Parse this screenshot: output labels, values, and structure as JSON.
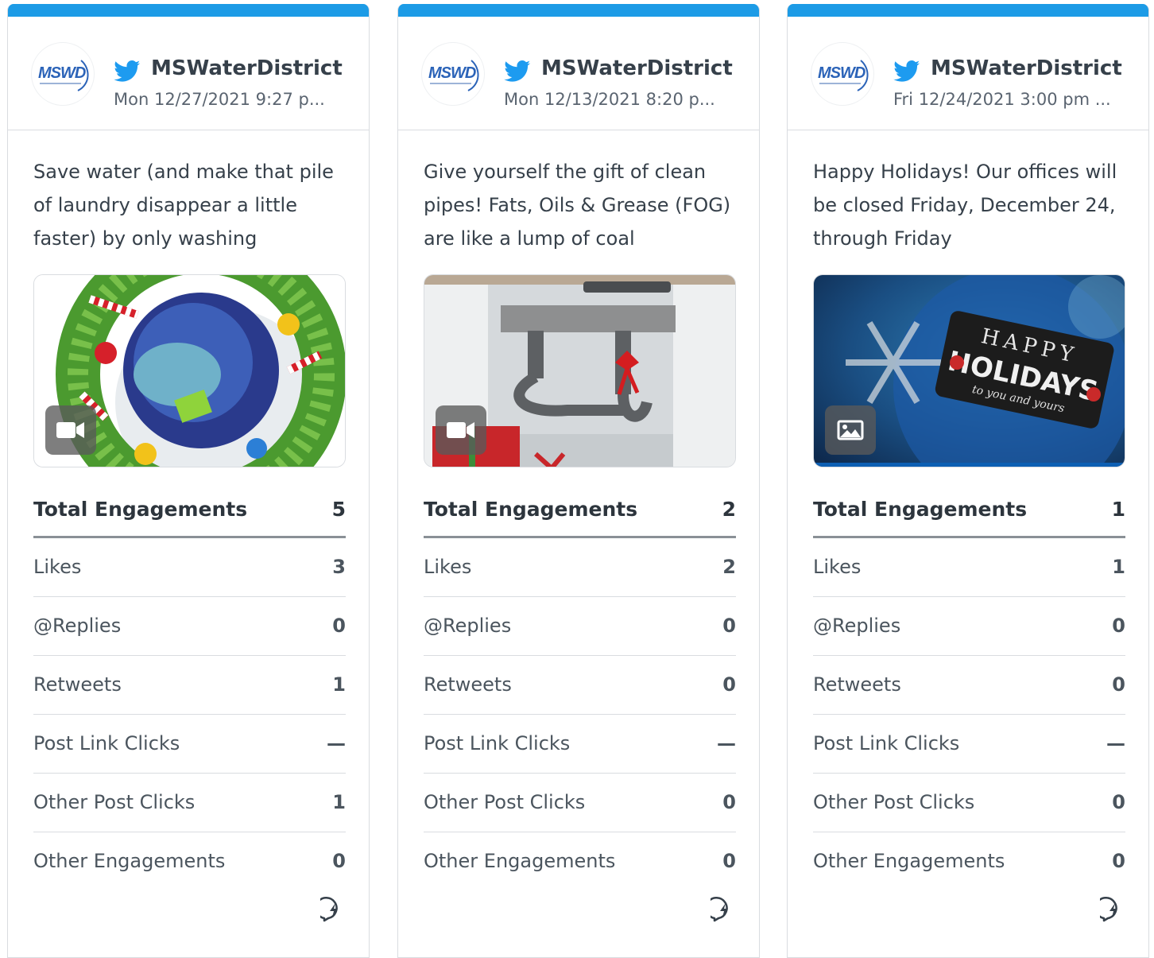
{
  "colors": {
    "accent": "#1c9be6",
    "twitter_blue": "#1d9bf0",
    "text": "#36404a",
    "muted": "#5a6470",
    "border": "#d9dce0"
  },
  "cards": [
    {
      "account": "MSWaterDistrict",
      "timestamp": "Mon 12/27/2021 9:27 p...",
      "text": "Save water (and make that pile of laundry disappear a little faster) by only washing",
      "media_type": "video",
      "media_icon": "video-camera-icon",
      "avatar_text": "MSWD",
      "metrics": {
        "total_label": "Total Engagements",
        "total_value": "5",
        "rows": [
          {
            "label": "Likes",
            "value": "3"
          },
          {
            "label": "@Replies",
            "value": "0"
          },
          {
            "label": "Retweets",
            "value": "1"
          },
          {
            "label": "Post Link Clicks",
            "value": "—"
          },
          {
            "label": "Other Post Clicks",
            "value": "1"
          },
          {
            "label": "Other Engagements",
            "value": "0"
          }
        ]
      }
    },
    {
      "account": "MSWaterDistrict",
      "timestamp": "Mon 12/13/2021 8:20 p...",
      "text": "Give yourself the gift of clean pipes! Fats, Oils & Grease (FOG) are like a lump of coal",
      "media_type": "video",
      "media_icon": "video-camera-icon",
      "avatar_text": "MSWD",
      "metrics": {
        "total_label": "Total Engagements",
        "total_value": "2",
        "rows": [
          {
            "label": "Likes",
            "value": "2"
          },
          {
            "label": "@Replies",
            "value": "0"
          },
          {
            "label": "Retweets",
            "value": "0"
          },
          {
            "label": "Post Link Clicks",
            "value": "—"
          },
          {
            "label": "Other Post Clicks",
            "value": "0"
          },
          {
            "label": "Other Engagements",
            "value": "0"
          }
        ]
      }
    },
    {
      "account": "MSWaterDistrict",
      "timestamp": "Fri 12/24/2021 3:00 pm ...",
      "text": "Happy Holidays! Our offices will be closed Friday, December 24, through Friday",
      "media_type": "image",
      "media_icon": "image-icon",
      "avatar_text": "MSWD",
      "image_lettering": [
        "HAPPY",
        "HOLIDAYS",
        "to you and yours"
      ],
      "metrics": {
        "total_label": "Total Engagements",
        "total_value": "1",
        "rows": [
          {
            "label": "Likes",
            "value": "1"
          },
          {
            "label": "@Replies",
            "value": "0"
          },
          {
            "label": "Retweets",
            "value": "0"
          },
          {
            "label": "Post Link Clicks",
            "value": "—"
          },
          {
            "label": "Other Post Clicks",
            "value": "0"
          },
          {
            "label": "Other Engagements",
            "value": "0"
          }
        ]
      }
    }
  ]
}
